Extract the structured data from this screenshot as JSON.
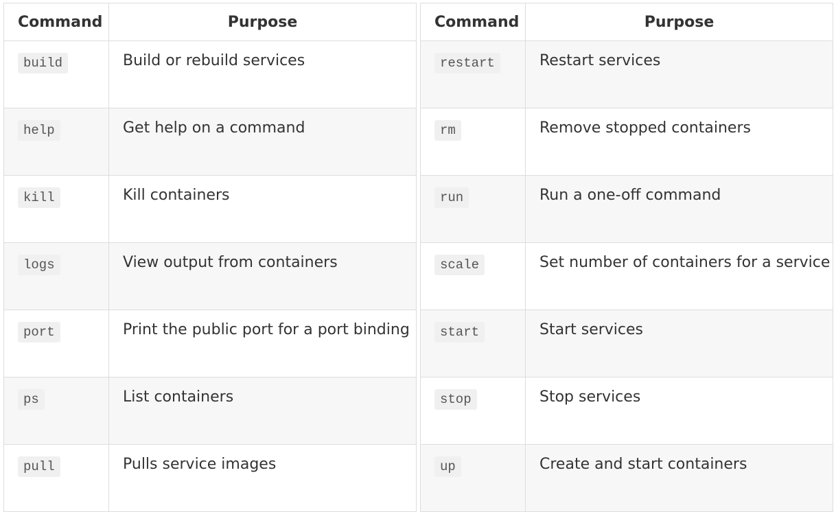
{
  "left_table": {
    "headers": {
      "command": "Command",
      "purpose": "Purpose"
    },
    "rows": [
      {
        "command": "build",
        "purpose": "Build or rebuild services"
      },
      {
        "command": "help",
        "purpose": "Get help on a command"
      },
      {
        "command": "kill",
        "purpose": "Kill containers"
      },
      {
        "command": "logs",
        "purpose": "View output from containers"
      },
      {
        "command": "port",
        "purpose": "Print the public port for a port binding"
      },
      {
        "command": "ps",
        "purpose": "List containers"
      },
      {
        "command": "pull",
        "purpose": "Pulls service images"
      }
    ]
  },
  "right_table": {
    "headers": {
      "command": "Command",
      "purpose": "Purpose"
    },
    "rows": [
      {
        "command": "restart",
        "purpose": "Restart services"
      },
      {
        "command": "rm",
        "purpose": "Remove stopped containers"
      },
      {
        "command": "run",
        "purpose": "Run a one-off command"
      },
      {
        "command": "scale",
        "purpose": "Set number of containers for a service"
      },
      {
        "command": "start",
        "purpose": "Start services"
      },
      {
        "command": "stop",
        "purpose": "Stop services"
      },
      {
        "command": "up",
        "purpose": "Create and start containers"
      }
    ]
  },
  "colors": {
    "border": "#dddddd",
    "row_shade": "#f7f7f7",
    "code_background": "#f0f0f0",
    "text": "#333333"
  }
}
